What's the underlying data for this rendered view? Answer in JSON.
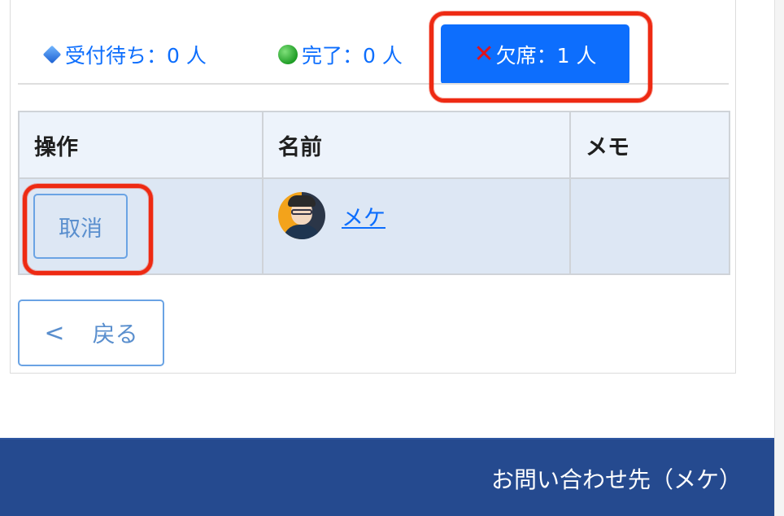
{
  "tabs": [
    {
      "icon": "blue-diamond-icon",
      "label": "受付待ち：0 人"
    },
    {
      "icon": "green-circle-icon",
      "label": "完了：0 人"
    },
    {
      "icon": "red-cross-icon",
      "label": "欠席：1 人",
      "active": true
    }
  ],
  "table": {
    "headers": [
      "操作",
      "名前",
      "メモ"
    ],
    "rows": [
      {
        "action_label": "取消",
        "name": " メケ",
        "memo": ""
      }
    ]
  },
  "back_button": {
    "chevron": "<",
    "label": "戻る"
  },
  "footer": {
    "contact_label": "お問い合わせ先（メケ）"
  },
  "colors": {
    "accent": "#0d6efd",
    "highlight": "#ee2a13",
    "footer_bg": "#254a8f"
  }
}
